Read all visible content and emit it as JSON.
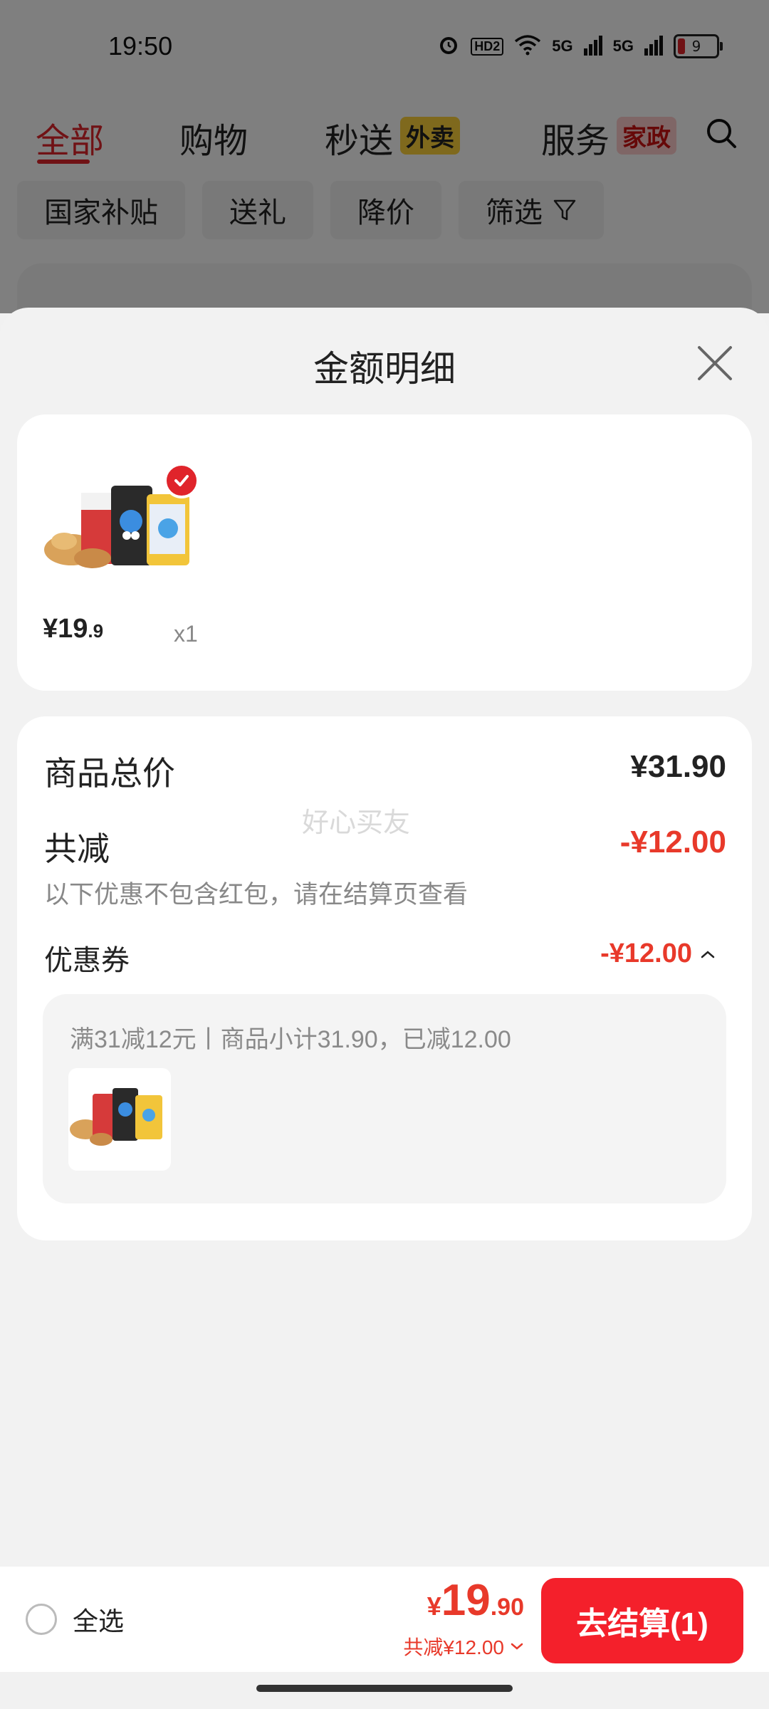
{
  "status": {
    "time": "19:50",
    "hd": "HD2",
    "net1": "5G",
    "net2": "5G",
    "battery": "9"
  },
  "tabs": [
    {
      "label": "全部"
    },
    {
      "label": "购物"
    },
    {
      "label": "秒送",
      "badge": "外卖"
    },
    {
      "label": "服务",
      "badge": "家政"
    }
  ],
  "filters": [
    "国家补贴",
    "送礼",
    "降价",
    "筛选"
  ],
  "sheet": {
    "title": "金额明细",
    "item": {
      "price_int": "¥19",
      "price_dec": ".9",
      "qty": "x1"
    },
    "summary": {
      "total_label": "商品总价",
      "total_value": "¥31.90",
      "discount_label": "共减",
      "discount_value": "-¥12.00",
      "note": "以下优惠不包含红包，请在结算页查看",
      "watermark": "好心买友",
      "coupon_label": "优惠券",
      "coupon_value": "-¥12.00",
      "coupon_desc": "满31减12元丨商品小计31.90，已减12.00"
    }
  },
  "bottom": {
    "select_all": "全选",
    "price_currency": "¥",
    "price_int": "19",
    "price_dec": ".90",
    "discount": "共减¥12.00",
    "checkout": "去结算(1)"
  },
  "colors": {
    "accent": "#e0242b",
    "price_red": "#e8392a",
    "checkout": "#f4202b"
  }
}
